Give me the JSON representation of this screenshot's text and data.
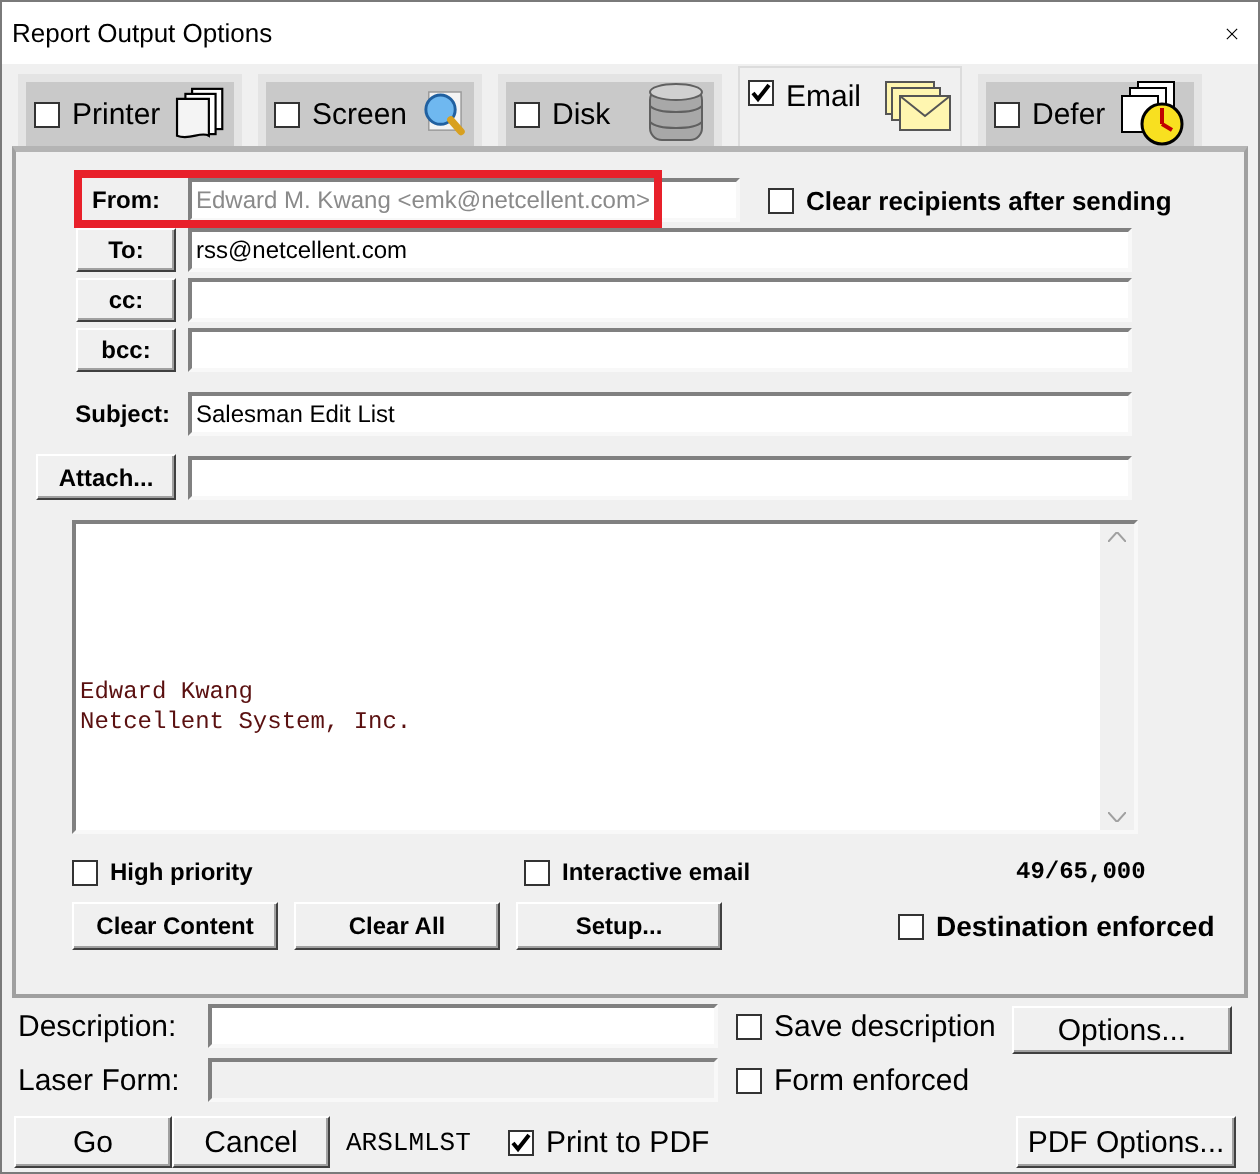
{
  "window": {
    "title": "Report Output Options"
  },
  "tabs": [
    {
      "label": "Printer",
      "checked": false,
      "selected": false
    },
    {
      "label": "Screen",
      "checked": false,
      "selected": false
    },
    {
      "label": "Disk",
      "checked": false,
      "selected": false
    },
    {
      "label": "Email",
      "checked": true,
      "selected": true
    },
    {
      "label": "Defer",
      "checked": false,
      "selected": false
    }
  ],
  "email": {
    "from": {
      "label": "From:",
      "value": "Edward M. Kwang <emk@netcellent.com>",
      "disabled": true,
      "highlighted": true
    },
    "clear_recipients": {
      "label": "Clear recipients after sending",
      "checked": false
    },
    "recipients": [
      {
        "label": "To:",
        "value": "rss@netcellent.com"
      },
      {
        "label": "cc:"
      },
      {
        "label": "bcc:"
      }
    ],
    "subject": {
      "label": "Subject:",
      "value": "Salesman Edit List"
    },
    "attach": {
      "label": "Attach..."
    },
    "body": {
      "lines": [
        "Edward Kwang",
        "Netcellent System, Inc."
      ]
    },
    "options": [
      {
        "label": "High priority",
        "checked": false
      },
      {
        "label": "Interactive email",
        "checked": false
      }
    ],
    "char_count": "49/65,000",
    "buttons": [
      "Clear Content",
      "Clear All",
      "Setup..."
    ],
    "destination_enforced": {
      "label": "Destination enforced",
      "checked": false
    }
  },
  "description": {
    "label": "Description:"
  },
  "save_description": {
    "label": "Save description",
    "checked": false
  },
  "options_button": "Options...",
  "laser_form": {
    "label": "Laser Form:",
    "disabled": true
  },
  "form_enforced": {
    "label": "Form enforced",
    "checked": false
  },
  "buttons": [
    "Go",
    "Cancel"
  ],
  "report_id": "ARSLMLST",
  "print_to_pdf": {
    "label": "Print to PDF",
    "checked": true
  },
  "pdf_options_button": "PDF Options..."
}
